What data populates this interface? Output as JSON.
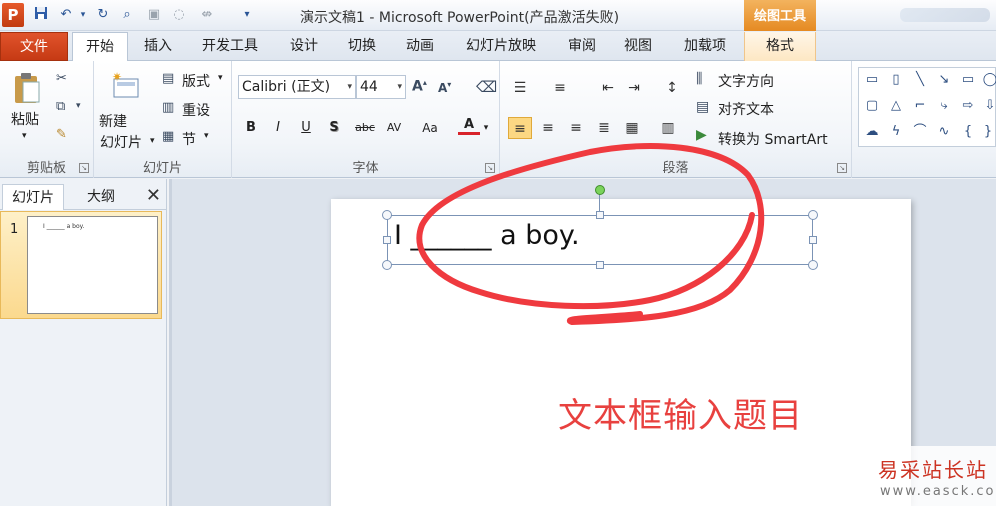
{
  "window": {
    "title": "演示文稿1 - Microsoft PowerPoint(产品激活失败)",
    "context_tab": "绘图工具"
  },
  "quick_access": {
    "icons": [
      "powerpoint-logo-icon",
      "save-icon",
      "undo-icon",
      "redo-icon",
      "find-icon",
      "paste-icon",
      "shape-icon",
      "customize-icon"
    ],
    "app_letter": "P"
  },
  "tabs": {
    "file": "文件",
    "items": [
      "开始",
      "插入",
      "开发工具",
      "设计",
      "切换",
      "动画",
      "幻灯片放映",
      "审阅",
      "视图",
      "加载项",
      "格式"
    ],
    "active": "开始"
  },
  "ribbon": {
    "clipboard": {
      "label": "剪贴板",
      "paste": "粘贴"
    },
    "slides": {
      "label": "幻灯片",
      "new_slide_line1": "新建",
      "new_slide_line2": "幻灯片",
      "layout": "版式",
      "reset": "重设",
      "section": "节"
    },
    "font": {
      "label": "字体",
      "font_name": "Calibri (正文)",
      "font_size": "44",
      "bold": "B",
      "italic": "I",
      "underline": "U",
      "shadow": "S",
      "strike": "abc",
      "spacing": "AV",
      "case": "Aa",
      "color": "A"
    },
    "paragraph": {
      "label": "段落",
      "text_direction": "文字方向",
      "align_text": "对齐文本",
      "smartart": "转换为 SmartArt"
    }
  },
  "left_panel": {
    "tab_slides": "幻灯片",
    "tab_outline": "大纲",
    "slide_number": "1",
    "thumb_text": "I ______ a boy."
  },
  "slide": {
    "text": "I  ______  a boy.",
    "caption": "文本框输入题目"
  },
  "watermark": {
    "title": "易采站长站",
    "url": "www.easck.com"
  },
  "colors": {
    "accent_file": "#c63a14",
    "context_tab": "#e58a22",
    "annotation": "#e8413f",
    "rotate_handle": "#7ad35b"
  }
}
